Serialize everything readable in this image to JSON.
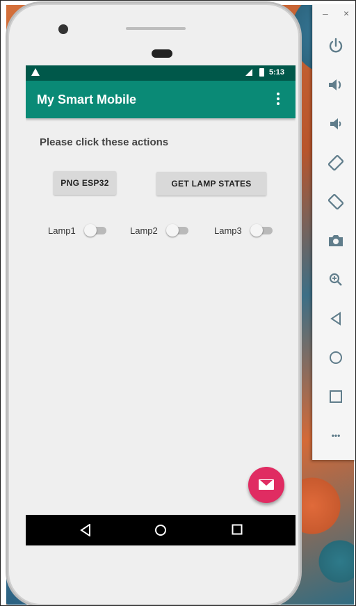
{
  "app": {
    "title": "My Smart Mobile",
    "status_time": "5:13"
  },
  "content": {
    "heading": "Please click these actions",
    "ping_button": "PNG ESP32",
    "lamp_states_button": "GET LAMP STATES"
  },
  "lamps": [
    {
      "label": "Lamp1",
      "on": false
    },
    {
      "label": "Lamp2",
      "on": false
    },
    {
      "label": "Lamp3",
      "on": false
    }
  ],
  "emulator_toolbar": {
    "minimize": "–",
    "close": "×",
    "more": "•••",
    "icons": [
      "power-icon",
      "volume-up-icon",
      "volume-down-icon",
      "rotate-left-icon",
      "rotate-right-icon",
      "camera-icon",
      "zoom-icon",
      "back-icon",
      "home-icon",
      "overview-icon",
      "more-icon"
    ]
  },
  "colors": {
    "status_bar": "#00584a",
    "app_bar": "#0a8a76",
    "fab": "#e02c62",
    "button": "#d9d9d9",
    "screen_bg": "#efefef"
  }
}
